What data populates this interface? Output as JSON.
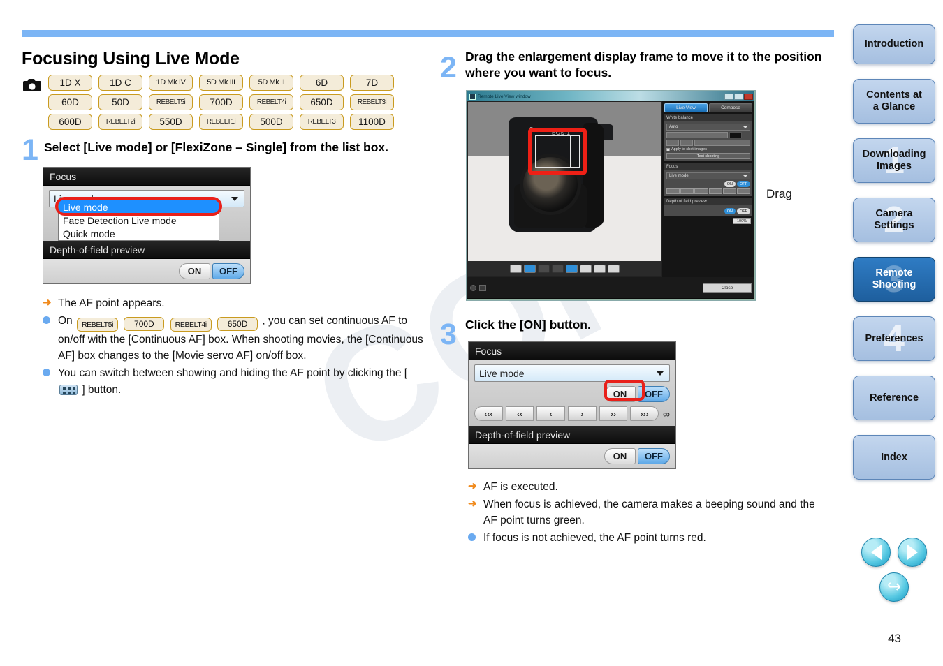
{
  "page": {
    "title": "Focusing Using Live Mode",
    "page_number": "43",
    "watermark": "COPY",
    "rule_color": "#7cb5f5"
  },
  "camera_models": {
    "icon": "camera-icon",
    "rows": [
      [
        "1D X",
        "1D C",
        "1D Mk IV",
        "5D Mk III",
        "5D Mk II",
        "6D",
        "7D"
      ],
      [
        "60D",
        "50D",
        "REBELT5i",
        "700D",
        "REBELT4i",
        "650D",
        "REBELT3i"
      ],
      [
        "600D",
        "REBELT2i",
        "550D",
        "REBELT1i",
        "500D",
        "REBELT3",
        "1100D"
      ]
    ],
    "badge_border_color": "#c99b20",
    "badge_fill_color": "#f4ecd9"
  },
  "steps": [
    {
      "number": "1",
      "title": "Select [Live mode] or [FlexiZone – Single] from the list box."
    },
    {
      "number": "2",
      "title": "Drag the enlargement display frame to move it to the position where you want to focus."
    },
    {
      "number": "3",
      "title": "Click the [ON] button."
    }
  ],
  "focus_panel_step1": {
    "header": "Focus",
    "combo_value": "Live mode",
    "dropdown_options": [
      "Live mode",
      "Face Detection Live mode",
      "Quick mode"
    ],
    "dropdown_selected": "Live mode",
    "dof_header": "Depth-of-field preview",
    "dof_on": "ON",
    "dof_off": "OFF",
    "highlight_color": "#e8201a"
  },
  "focus_panel_step3": {
    "header": "Focus",
    "combo_value": "Live mode",
    "af_on": "ON",
    "af_off": "OFF",
    "focus_steps": [
      "‹‹‹",
      "‹‹",
      "‹",
      "›",
      "››",
      "›››"
    ],
    "infinity": "∞",
    "dof_header": "Depth-of-field preview",
    "dof_on": "ON",
    "dof_off": "OFF"
  },
  "remote_live_view": {
    "window_title": "Remote Live View window",
    "tabs": [
      "Live View",
      "Compose"
    ],
    "active_tab": "Live View",
    "sections": {
      "white_balance": "White balance",
      "wb_value": "Auto",
      "apply_to_shot": "Apply to shot images",
      "test_shooting": "Test shooting",
      "focus": "Focus",
      "focus_value": "Live mode",
      "focus_on": "ON",
      "focus_off": "OFF",
      "dof": "Depth of field preview",
      "dof_on": "ON",
      "dof_off": "OFF",
      "zoom_label": "100%"
    },
    "close_button": "Close",
    "callout": "Drag"
  },
  "bullets_step1": [
    {
      "marker": "arrow",
      "text": "The AF point appears."
    },
    {
      "marker": "dot",
      "type": "models",
      "lead": "On",
      "models": [
        "REBELT5i",
        "700D",
        "REBELT4i",
        "650D"
      ],
      "text": ", you can set continuous AF to on/off with the [Continuous AF] box. When shooting movies, the [Continuous AF] box changes to the [Movie servo AF] on/off box."
    },
    {
      "marker": "dot",
      "type": "afpoint",
      "text_before": "You can switch between showing and hiding the AF point by clicking the [",
      "text_after": "] button."
    }
  ],
  "bullets_step3": [
    {
      "marker": "arrow",
      "text": "AF is executed."
    },
    {
      "marker": "arrow",
      "text": "When focus is achieved, the camera makes a beeping sound and the AF point turns green."
    },
    {
      "marker": "dot",
      "text": "If focus is not achieved, the AF point turns red."
    }
  ],
  "sidebar": {
    "items": [
      {
        "label": "Introduction",
        "watermark": "",
        "active": false
      },
      {
        "label": "Contents at\na Glance",
        "watermark": "",
        "active": false
      },
      {
        "label": "Downloading\nImages",
        "watermark": "1",
        "active": false
      },
      {
        "label": "Camera\nSettings",
        "watermark": "2",
        "active": false
      },
      {
        "label": "Remote\nShooting",
        "watermark": "3",
        "active": true
      },
      {
        "label": "Preferences",
        "watermark": "4",
        "active": false
      },
      {
        "label": "Reference",
        "watermark": "",
        "active": false
      },
      {
        "label": "Index",
        "watermark": "",
        "active": false
      }
    ],
    "active_color": "#1e5f9e",
    "inactive_color": "#a5bfe0"
  },
  "nav_buttons": {
    "previous": "previous-page-icon",
    "next": "next-page-icon",
    "back": "go-back-icon"
  }
}
